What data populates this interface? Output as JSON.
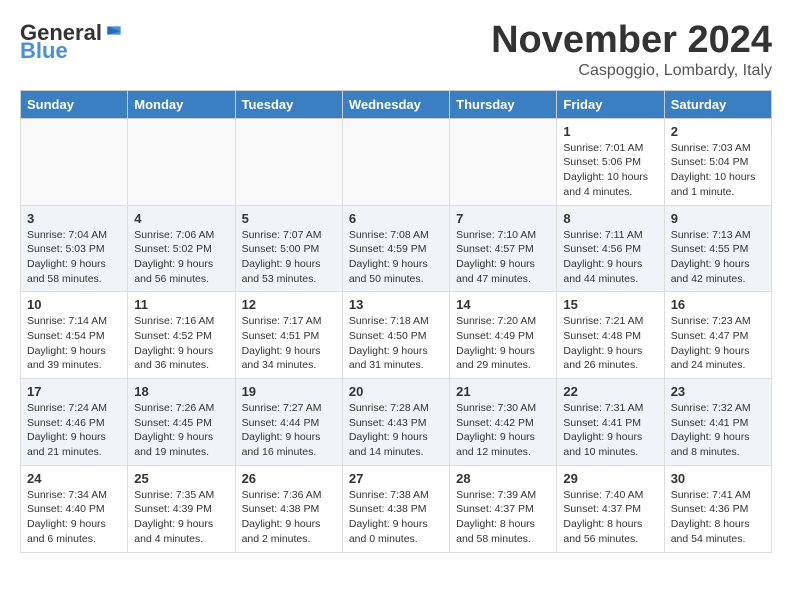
{
  "header": {
    "logo_general": "General",
    "logo_blue": "Blue",
    "month_title": "November 2024",
    "location": "Caspoggio, Lombardy, Italy"
  },
  "weekdays": [
    "Sunday",
    "Monday",
    "Tuesday",
    "Wednesday",
    "Thursday",
    "Friday",
    "Saturday"
  ],
  "weeks": [
    [
      {
        "day": "",
        "info": ""
      },
      {
        "day": "",
        "info": ""
      },
      {
        "day": "",
        "info": ""
      },
      {
        "day": "",
        "info": ""
      },
      {
        "day": "",
        "info": ""
      },
      {
        "day": "1",
        "info": "Sunrise: 7:01 AM\nSunset: 5:06 PM\nDaylight: 10 hours\nand 4 minutes."
      },
      {
        "day": "2",
        "info": "Sunrise: 7:03 AM\nSunset: 5:04 PM\nDaylight: 10 hours\nand 1 minute."
      }
    ],
    [
      {
        "day": "3",
        "info": "Sunrise: 7:04 AM\nSunset: 5:03 PM\nDaylight: 9 hours\nand 58 minutes."
      },
      {
        "day": "4",
        "info": "Sunrise: 7:06 AM\nSunset: 5:02 PM\nDaylight: 9 hours\nand 56 minutes."
      },
      {
        "day": "5",
        "info": "Sunrise: 7:07 AM\nSunset: 5:00 PM\nDaylight: 9 hours\nand 53 minutes."
      },
      {
        "day": "6",
        "info": "Sunrise: 7:08 AM\nSunset: 4:59 PM\nDaylight: 9 hours\nand 50 minutes."
      },
      {
        "day": "7",
        "info": "Sunrise: 7:10 AM\nSunset: 4:57 PM\nDaylight: 9 hours\nand 47 minutes."
      },
      {
        "day": "8",
        "info": "Sunrise: 7:11 AM\nSunset: 4:56 PM\nDaylight: 9 hours\nand 44 minutes."
      },
      {
        "day": "9",
        "info": "Sunrise: 7:13 AM\nSunset: 4:55 PM\nDaylight: 9 hours\nand 42 minutes."
      }
    ],
    [
      {
        "day": "10",
        "info": "Sunrise: 7:14 AM\nSunset: 4:54 PM\nDaylight: 9 hours\nand 39 minutes."
      },
      {
        "day": "11",
        "info": "Sunrise: 7:16 AM\nSunset: 4:52 PM\nDaylight: 9 hours\nand 36 minutes."
      },
      {
        "day": "12",
        "info": "Sunrise: 7:17 AM\nSunset: 4:51 PM\nDaylight: 9 hours\nand 34 minutes."
      },
      {
        "day": "13",
        "info": "Sunrise: 7:18 AM\nSunset: 4:50 PM\nDaylight: 9 hours\nand 31 minutes."
      },
      {
        "day": "14",
        "info": "Sunrise: 7:20 AM\nSunset: 4:49 PM\nDaylight: 9 hours\nand 29 minutes."
      },
      {
        "day": "15",
        "info": "Sunrise: 7:21 AM\nSunset: 4:48 PM\nDaylight: 9 hours\nand 26 minutes."
      },
      {
        "day": "16",
        "info": "Sunrise: 7:23 AM\nSunset: 4:47 PM\nDaylight: 9 hours\nand 24 minutes."
      }
    ],
    [
      {
        "day": "17",
        "info": "Sunrise: 7:24 AM\nSunset: 4:46 PM\nDaylight: 9 hours\nand 21 minutes."
      },
      {
        "day": "18",
        "info": "Sunrise: 7:26 AM\nSunset: 4:45 PM\nDaylight: 9 hours\nand 19 minutes."
      },
      {
        "day": "19",
        "info": "Sunrise: 7:27 AM\nSunset: 4:44 PM\nDaylight: 9 hours\nand 16 minutes."
      },
      {
        "day": "20",
        "info": "Sunrise: 7:28 AM\nSunset: 4:43 PM\nDaylight: 9 hours\nand 14 minutes."
      },
      {
        "day": "21",
        "info": "Sunrise: 7:30 AM\nSunset: 4:42 PM\nDaylight: 9 hours\nand 12 minutes."
      },
      {
        "day": "22",
        "info": "Sunrise: 7:31 AM\nSunset: 4:41 PM\nDaylight: 9 hours\nand 10 minutes."
      },
      {
        "day": "23",
        "info": "Sunrise: 7:32 AM\nSunset: 4:41 PM\nDaylight: 9 hours\nand 8 minutes."
      }
    ],
    [
      {
        "day": "24",
        "info": "Sunrise: 7:34 AM\nSunset: 4:40 PM\nDaylight: 9 hours\nand 6 minutes."
      },
      {
        "day": "25",
        "info": "Sunrise: 7:35 AM\nSunset: 4:39 PM\nDaylight: 9 hours\nand 4 minutes."
      },
      {
        "day": "26",
        "info": "Sunrise: 7:36 AM\nSunset: 4:38 PM\nDaylight: 9 hours\nand 2 minutes."
      },
      {
        "day": "27",
        "info": "Sunrise: 7:38 AM\nSunset: 4:38 PM\nDaylight: 9 hours\nand 0 minutes."
      },
      {
        "day": "28",
        "info": "Sunrise: 7:39 AM\nSunset: 4:37 PM\nDaylight: 8 hours\nand 58 minutes."
      },
      {
        "day": "29",
        "info": "Sunrise: 7:40 AM\nSunset: 4:37 PM\nDaylight: 8 hours\nand 56 minutes."
      },
      {
        "day": "30",
        "info": "Sunrise: 7:41 AM\nSunset: 4:36 PM\nDaylight: 8 hours\nand 54 minutes."
      }
    ]
  ]
}
